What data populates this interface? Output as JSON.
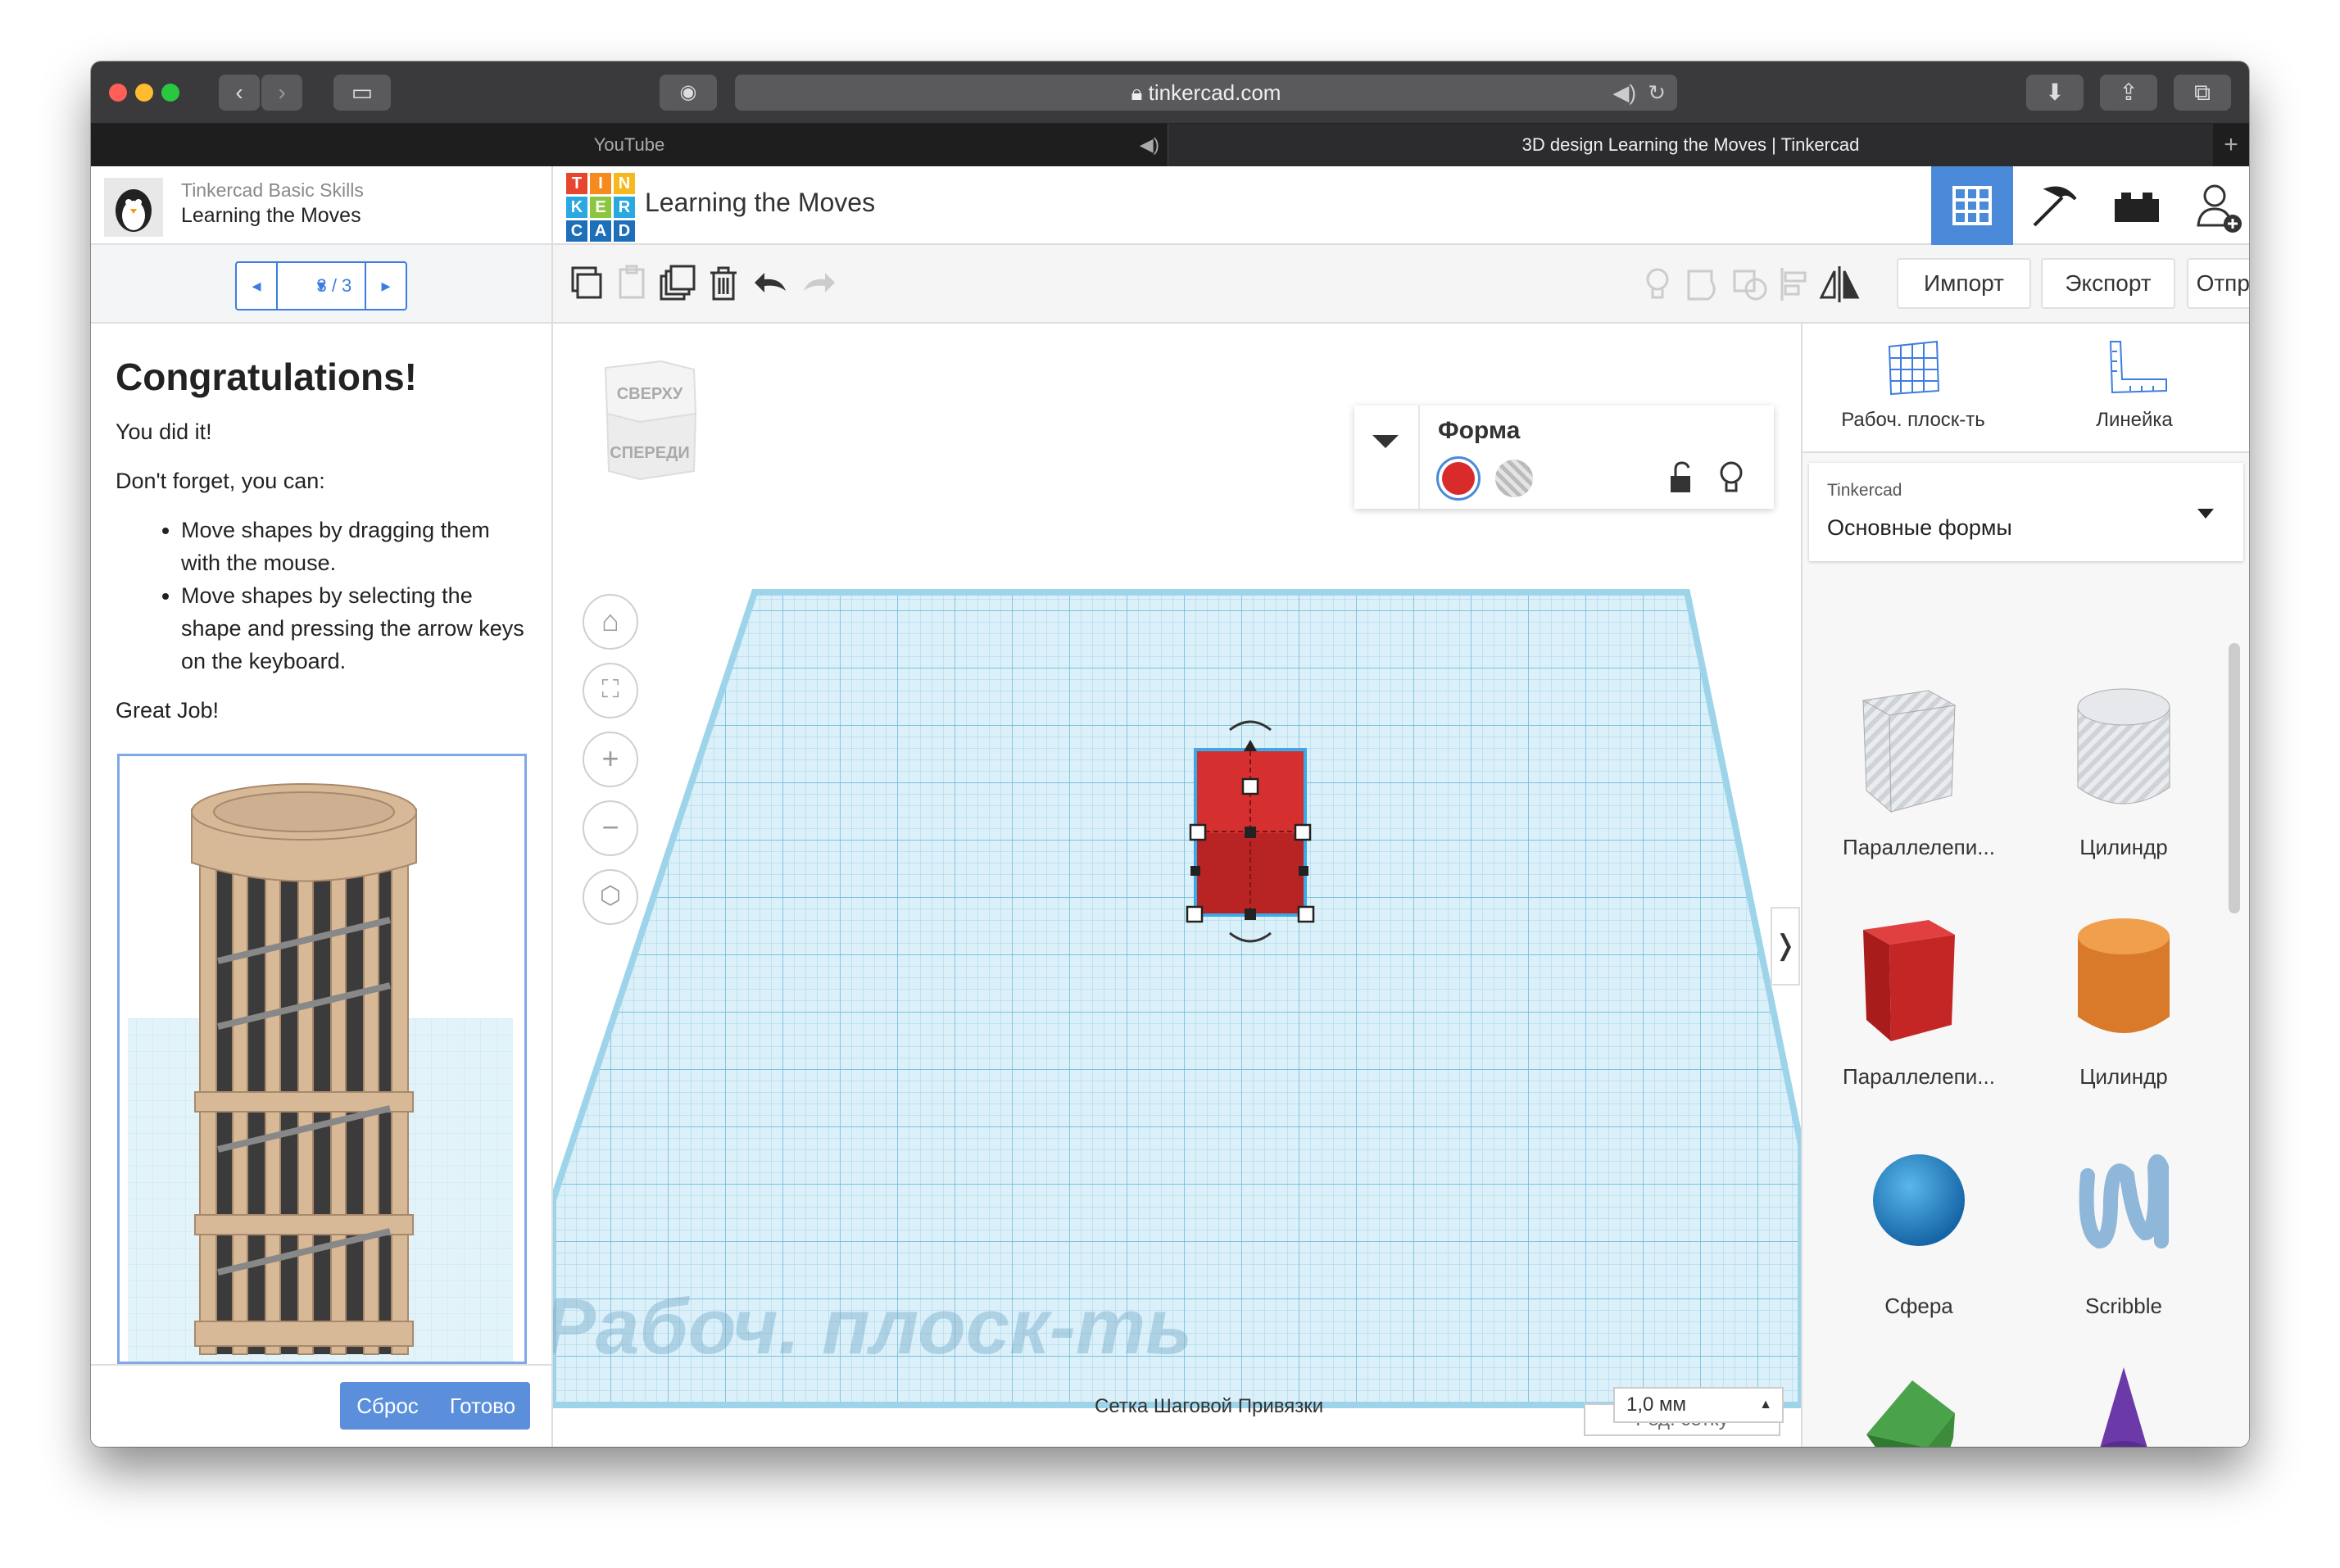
{
  "browser": {
    "url": "tinkercad.com",
    "tabs": [
      {
        "label": "YouTube",
        "active": false
      },
      {
        "label": "3D design Learning the Moves | Tinkercad",
        "active": true
      }
    ]
  },
  "lesson": {
    "course": "Tinkercad Basic Skills",
    "title": "Learning the Moves",
    "pager": "3 / 3",
    "heading": "Congratulations!",
    "p1": "You did it!",
    "p2": "Don't forget, you can:",
    "bullets": [
      "Move shapes by dragging them with the mouse.",
      "Move shapes by selecting the shape and pressing the arrow keys on the keyboard."
    ],
    "p3": "Great Job!",
    "reset_label": "Сброс",
    "done_label": "Готово"
  },
  "header": {
    "logo_letters": [
      "T",
      "I",
      "N",
      "K",
      "E",
      "R",
      "C",
      "A",
      "D"
    ],
    "design_title": "Learning the Moves"
  },
  "toolbar": {
    "import_label": "Импорт",
    "export_label": "Экспорт",
    "send_label": "Отправить"
  },
  "viewcube": {
    "top": "СВЕРХУ",
    "front": "СПЕРЕДИ"
  },
  "shape_panel": {
    "title": "Форма",
    "color": "#d92b2b"
  },
  "workplane": {
    "watermark": "Рабоч. плоск-ть",
    "edit_grid": "Ред. сетку",
    "snap_label": "Сетка Шаговой Привязки",
    "snap_value": "1,0 мм"
  },
  "library": {
    "workplane_label": "Рабоч. плоск-ть",
    "ruler_label": "Линейка",
    "provider": "Tinkercad",
    "category": "Основные формы",
    "shapes": [
      {
        "label": "Параллелепи...",
        "icon": "box-hole-icon"
      },
      {
        "label": "Цилиндр",
        "icon": "cylinder-hole-icon"
      },
      {
        "label": "Параллелепи...",
        "icon": "box-icon"
      },
      {
        "label": "Цилиндр",
        "icon": "cylinder-icon"
      },
      {
        "label": "Сфера",
        "icon": "sphere-icon"
      },
      {
        "label": "Scribble",
        "icon": "scribble-icon"
      },
      {
        "label": "",
        "icon": "roof-icon"
      },
      {
        "label": "",
        "icon": "cone-icon"
      }
    ]
  }
}
